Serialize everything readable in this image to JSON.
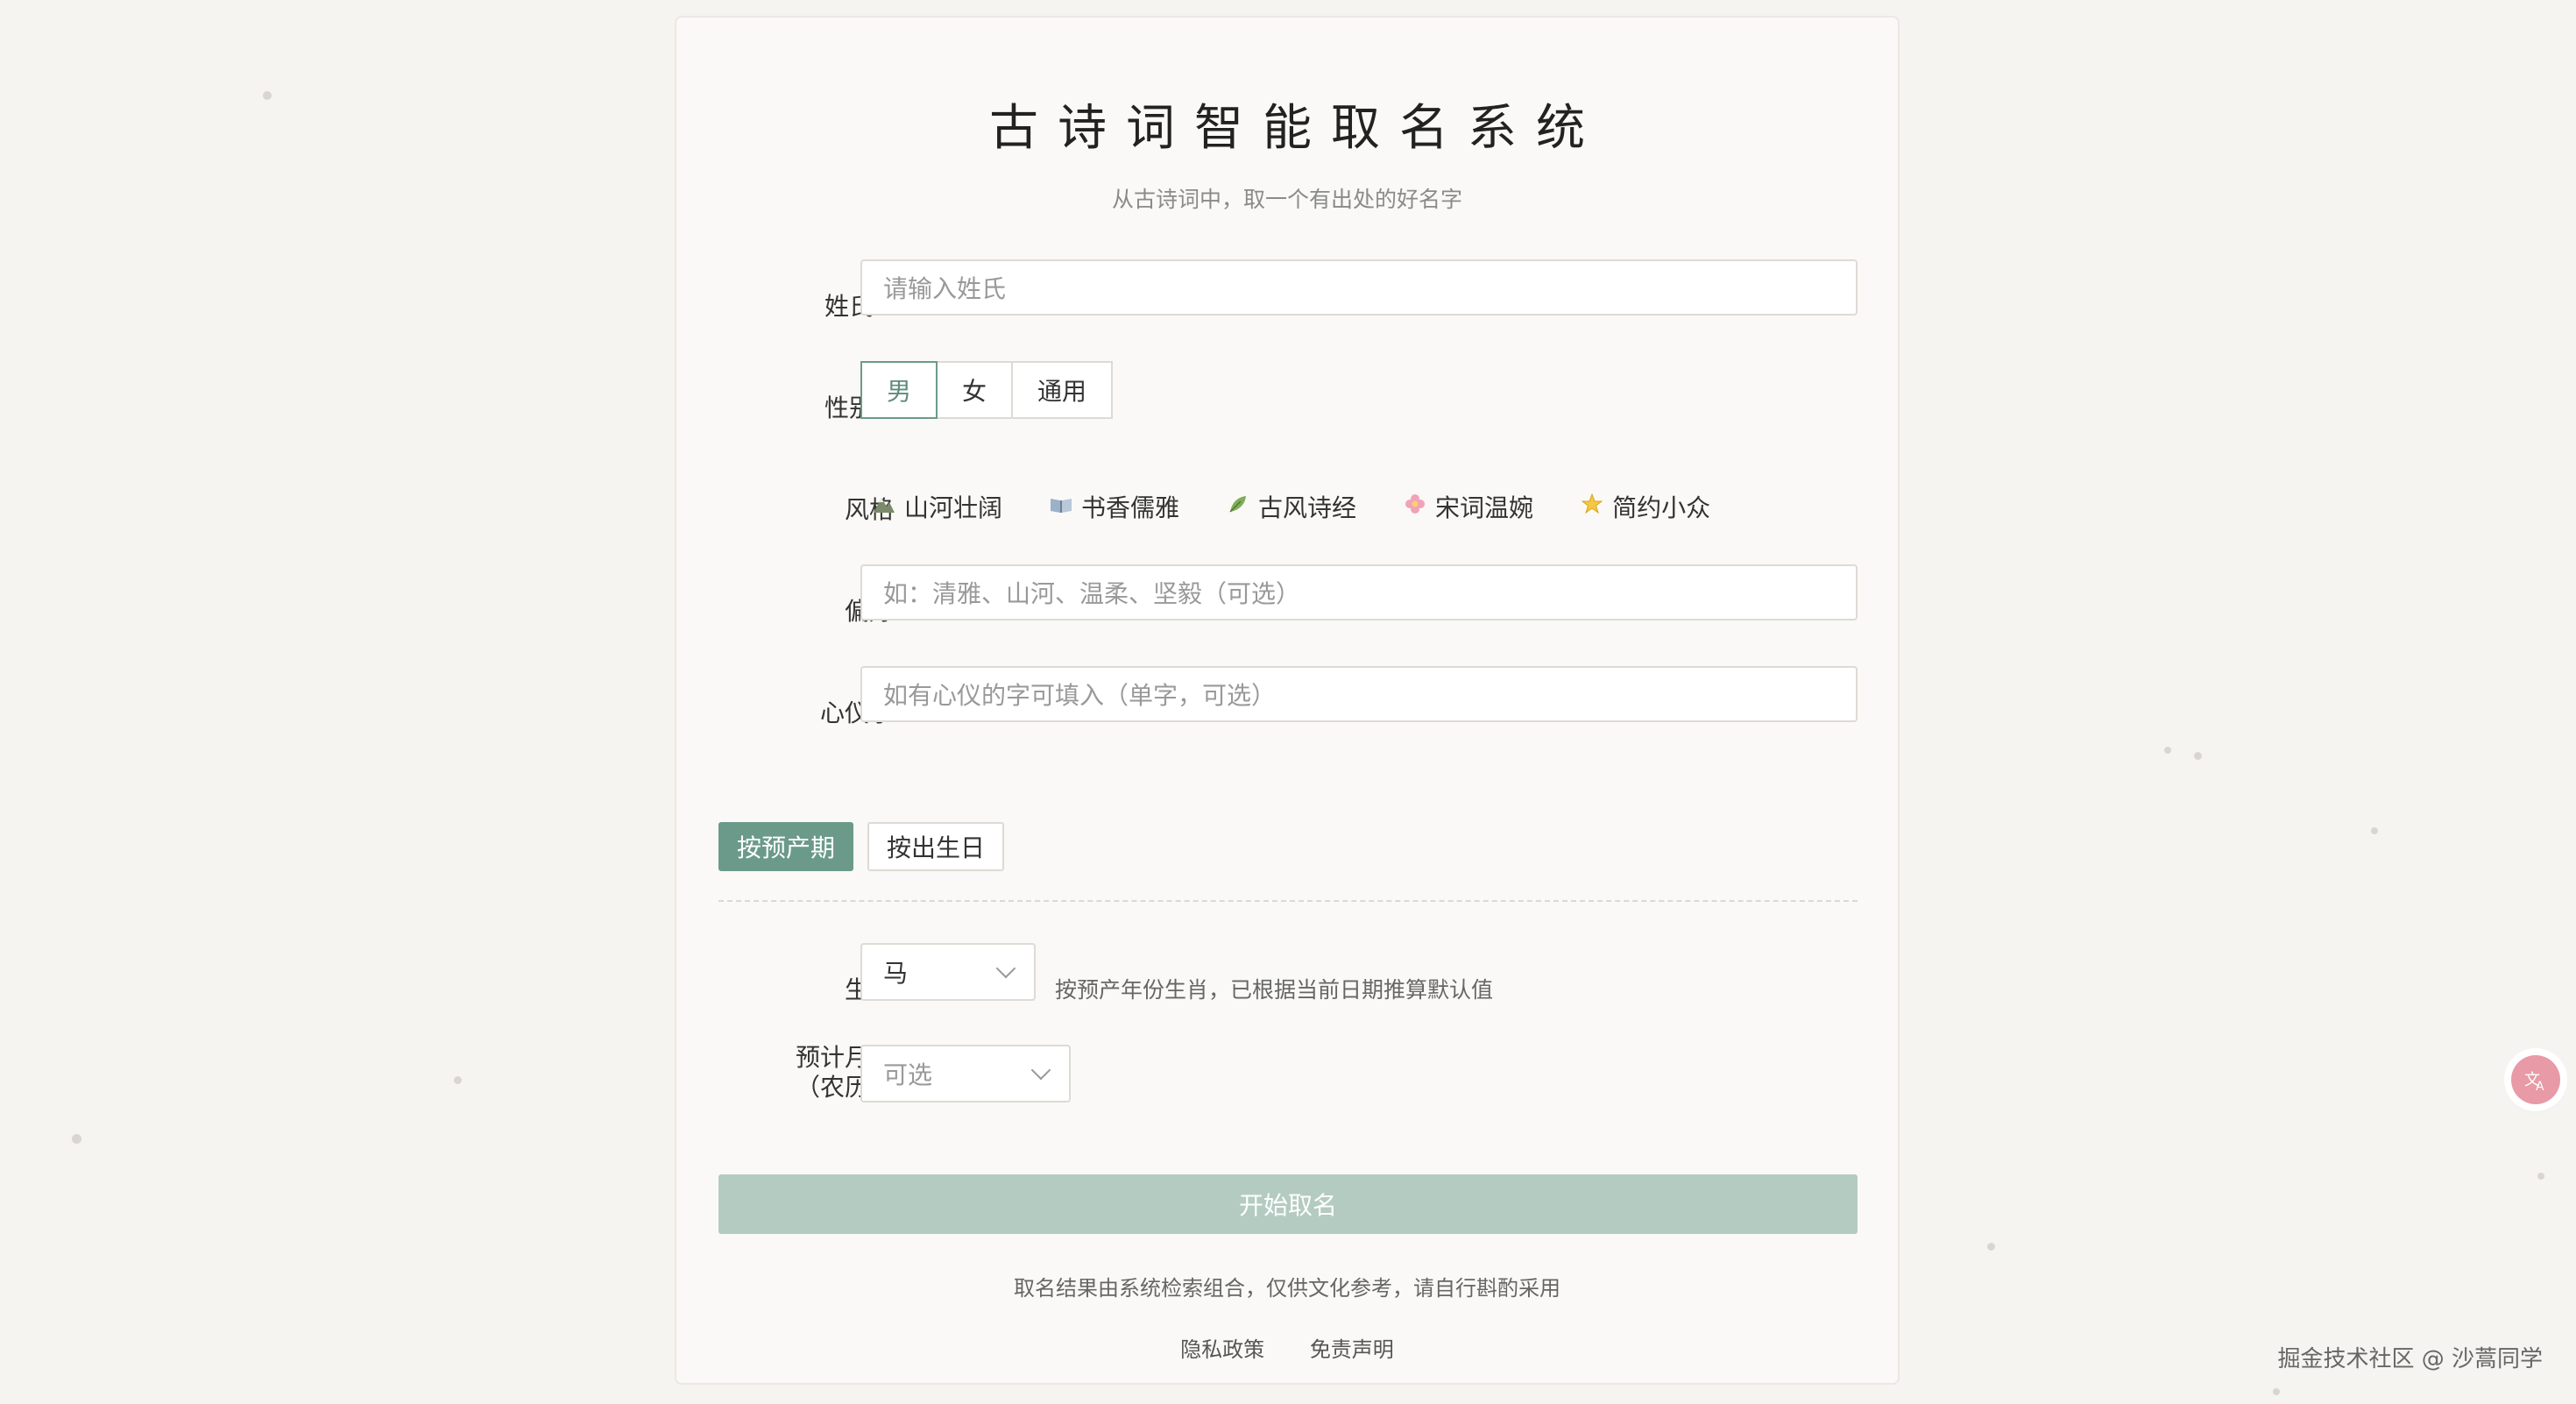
{
  "header": {
    "title": "古诗词智能取名系统",
    "subtitle": "从古诗词中，取一个有出处的好名字"
  },
  "form": {
    "surname": {
      "label": "姓氏",
      "placeholder": "请输入姓氏"
    },
    "gender": {
      "label": "性别",
      "options": [
        "男",
        "女",
        "通用"
      ],
      "selected": "男"
    },
    "style": {
      "label": "风格",
      "options": [
        {
          "icon": "mountain-icon",
          "label": "山河壮阔"
        },
        {
          "icon": "book-icon",
          "label": "书香儒雅"
        },
        {
          "icon": "leaf-icon",
          "label": "古风诗经"
        },
        {
          "icon": "flower-icon",
          "label": "宋词温婉"
        },
        {
          "icon": "star-icon",
          "label": "简约小众"
        }
      ]
    },
    "preference": {
      "label": "偏好",
      "placeholder": "如：清雅、山河、温柔、坚毅（可选）"
    },
    "favorite_char": {
      "label": "心仪字",
      "placeholder": "如有心仪的字可填入（单字，可选）"
    },
    "mode": {
      "options": [
        "按预产期",
        "按出生日"
      ],
      "selected": "按预产期"
    },
    "zodiac": {
      "label": "生肖",
      "value": "马",
      "hint": "按预产年份生肖，已根据当前日期推算默认值"
    },
    "due_month": {
      "label_line1": "预计月份",
      "label_line2": "（农历）",
      "placeholder": "可选"
    },
    "submit_label": "开始取名"
  },
  "footer": {
    "disclaimer": "取名结果由系统检索组合，仅供文化参考，请自行斟酌采用",
    "links": [
      "隐私政策",
      "免责声明"
    ]
  },
  "watermark": "掘金技术社区 @ 沙蒿同学",
  "colors": {
    "accent": "#6b9a8b",
    "submit_disabled": "#b4cbc2",
    "required": "#d3556b"
  }
}
